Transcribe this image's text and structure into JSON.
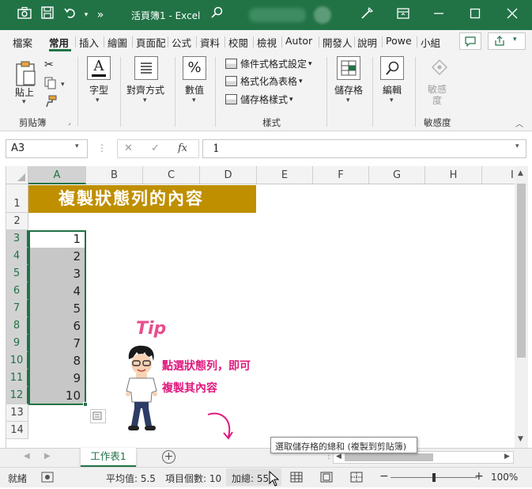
{
  "titlebar": {
    "quick_more": "»",
    "doc_title": "活頁簿1 - Excel",
    "search_glyph": "⌕"
  },
  "tabs": [
    "檔案",
    "常用",
    "插入",
    "繪圖",
    "頁面配",
    "公式",
    "資料",
    "校閱",
    "檢視",
    "Autor",
    "開發人",
    "說明",
    "Powe",
    "小組"
  ],
  "ribbon": {
    "paste_label": "貼上",
    "clipboard_label": "剪貼簿",
    "font_label": "字型",
    "align_label": "對齊方式",
    "number_label": "數值",
    "number_glyph": "%",
    "cond_format": "條件式格式設定",
    "format_table": "格式化為表格",
    "cell_styles": "儲存格樣式",
    "styles_label": "樣式",
    "cells_label": "儲存格",
    "editing_label": "編輯",
    "sensitivity_btn": "敏感度",
    "sensitivity_label": "敏感度"
  },
  "formula_bar": {
    "name_box": "A3",
    "cancel": "✕",
    "enter": "✓",
    "fx": "fx",
    "content": "1"
  },
  "columns": [
    "A",
    "B",
    "C",
    "D",
    "E",
    "F",
    "G",
    "H",
    "I"
  ],
  "rows": [
    "1",
    "2",
    "3",
    "4",
    "5",
    "6",
    "7",
    "8",
    "9",
    "10",
    "11",
    "12",
    "13",
    "14"
  ],
  "banner_text": "複製狀態列的內容",
  "cell_values": [
    "1",
    "2",
    "3",
    "4",
    "5",
    "6",
    "7",
    "8",
    "9",
    "10"
  ],
  "tip": {
    "badge": "Tip",
    "line1": "點選狀態列，即可",
    "line2": "複製其內容"
  },
  "sheet_tab": "工作表1",
  "tooltip": "選取儲存格的總和 (複製到剪貼簿)",
  "status": {
    "ready": "就緒",
    "average": "平均值: 5.5",
    "count": "項目個數: 10",
    "sum": "加總: 55",
    "zoom": "100%",
    "zoom_fraction": 0.5
  },
  "colors": {
    "excel_green": "#217346",
    "banner": "#bf8f00",
    "tip_pink": "#e0197d"
  }
}
